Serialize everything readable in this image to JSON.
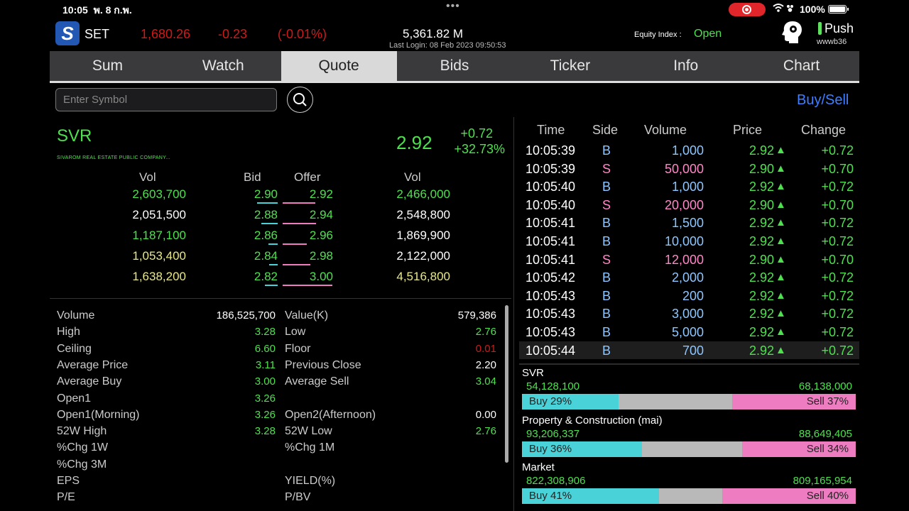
{
  "status_bar": {
    "time": "10:05",
    "date": "พ. 8 ก.พ.",
    "battery": "100%"
  },
  "header": {
    "market": "SET",
    "index": "1,680.26",
    "change": "-0.23",
    "change_pct": "(-0.01%)",
    "value": "5,361.82 M",
    "last_login": "Last Login: 08 Feb 2023 09:50:53",
    "equity_label": "Equity Index :",
    "equity_status": "Open",
    "push_label": "Push",
    "user": "wwwb36"
  },
  "tabs": [
    {
      "label": "Sum",
      "active": false
    },
    {
      "label": "Watch",
      "active": false
    },
    {
      "label": "Quote",
      "active": true
    },
    {
      "label": "Bids",
      "active": false
    },
    {
      "label": "Ticker",
      "active": false
    },
    {
      "label": "Info",
      "active": false
    },
    {
      "label": "Chart",
      "active": false
    }
  ],
  "search": {
    "placeholder": "Enter Symbol",
    "buysell_label": "Buy/Sell"
  },
  "quote": {
    "symbol": "SVR",
    "company": "SIVAROM REAL ESTATE PUBLIC COMPANY...",
    "last": "2.92",
    "change": "+0.72",
    "change_pct": "+32.73%"
  },
  "bidoffer": {
    "headers": {
      "bid_vol": "Vol",
      "bid": "Bid",
      "offer": "Offer",
      "offer_vol": "Vol"
    },
    "rows": [
      {
        "bid_vol": "2,603,700",
        "bid": "2.90",
        "offer": "2.92",
        "offer_vol": "2,466,000",
        "bid_share": 0.7,
        "offer_share": 0.65
      },
      {
        "bid_vol": "2,051,500",
        "bid": "2.88",
        "offer": "2.94",
        "offer_vol": "2,548,800",
        "bid_share": 0.55,
        "offer_share": 0.67
      },
      {
        "bid_vol": "1,187,100",
        "bid": "2.86",
        "offer": "2.96",
        "offer_vol": "1,869,900",
        "bid_share": 0.32,
        "offer_share": 0.49
      },
      {
        "bid_vol": "1,053,400",
        "bid": "2.84",
        "offer": "2.98",
        "offer_vol": "2,122,000",
        "bid_share": 0.28,
        "offer_share": 0.56
      },
      {
        "bid_vol": "1,638,200",
        "bid": "2.82",
        "offer": "3.00",
        "offer_vol": "4,516,800",
        "bid_share": 0.43,
        "offer_share": 1.0
      }
    ]
  },
  "stats": {
    "left": [
      {
        "label": "Volume",
        "value": "186,525,700",
        "color": "#ffffff"
      },
      {
        "label": "High",
        "value": "3.28",
        "color": "#4fe04f"
      },
      {
        "label": "Ceiling",
        "value": "6.60",
        "color": "#4fe04f"
      },
      {
        "label": "Average Price",
        "value": "3.11",
        "color": "#4fe04f"
      },
      {
        "label": "Average Buy",
        "value": "3.00",
        "color": "#4fe04f"
      },
      {
        "label": "Open1",
        "value": "3.26",
        "color": "#4fe04f"
      },
      {
        "label": "Open1(Morning)",
        "value": "3.26",
        "color": "#4fe04f"
      },
      {
        "label": "52W High",
        "value": "3.28",
        "color": "#4fe04f"
      },
      {
        "label": "%Chg 1W",
        "value": "",
        "color": "#ffffff"
      },
      {
        "label": "%Chg 3M",
        "value": "",
        "color": "#ffffff"
      },
      {
        "label": "EPS",
        "value": "",
        "color": "#ffffff"
      },
      {
        "label": "P/E",
        "value": "",
        "color": "#ffffff"
      }
    ],
    "right": [
      {
        "label": "Value(K)",
        "value": "579,386",
        "color": "#ffffff"
      },
      {
        "label": "Low",
        "value": "2.76",
        "color": "#4fe04f"
      },
      {
        "label": "Floor",
        "value": "0.01",
        "color": "#d01a1a"
      },
      {
        "label": "Previous Close",
        "value": "2.20",
        "color": "#ffffff"
      },
      {
        "label": "Average Sell",
        "value": "3.04",
        "color": "#4fe04f"
      },
      {
        "label": "",
        "value": "",
        "color": "#ffffff"
      },
      {
        "label": "Open2(Afternoon)",
        "value": "0.00",
        "color": "#ffffff"
      },
      {
        "label": "52W Low",
        "value": "2.76",
        "color": "#4fe04f"
      },
      {
        "label": "%Chg 1M",
        "value": "",
        "color": "#ffffff"
      },
      {
        "label": "",
        "value": "",
        "color": "#ffffff"
      },
      {
        "label": "YIELD(%)",
        "value": "",
        "color": "#ffffff"
      },
      {
        "label": "P/BV",
        "value": "",
        "color": "#ffffff"
      }
    ]
  },
  "ticker": {
    "headers": {
      "time": "Time",
      "side": "Side",
      "volume": "Volume",
      "price": "Price",
      "change": "Change"
    },
    "rows": [
      {
        "time": "10:05:39",
        "side": "B",
        "volume": "1,000",
        "price": "2.92",
        "change": "+0.72"
      },
      {
        "time": "10:05:39",
        "side": "S",
        "volume": "50,000",
        "price": "2.90",
        "change": "+0.70"
      },
      {
        "time": "10:05:40",
        "side": "B",
        "volume": "1,000",
        "price": "2.92",
        "change": "+0.72"
      },
      {
        "time": "10:05:40",
        "side": "S",
        "volume": "20,000",
        "price": "2.90",
        "change": "+0.70"
      },
      {
        "time": "10:05:41",
        "side": "B",
        "volume": "1,500",
        "price": "2.92",
        "change": "+0.72"
      },
      {
        "time": "10:05:41",
        "side": "B",
        "volume": "10,000",
        "price": "2.92",
        "change": "+0.72"
      },
      {
        "time": "10:05:41",
        "side": "S",
        "volume": "12,000",
        "price": "2.90",
        "change": "+0.70"
      },
      {
        "time": "10:05:42",
        "side": "B",
        "volume": "2,000",
        "price": "2.92",
        "change": "+0.72"
      },
      {
        "time": "10:05:43",
        "side": "B",
        "volume": "200",
        "price": "2.92",
        "change": "+0.72"
      },
      {
        "time": "10:05:43",
        "side": "B",
        "volume": "3,000",
        "price": "2.92",
        "change": "+0.72"
      },
      {
        "time": "10:05:43",
        "side": "B",
        "volume": "5,000",
        "price": "2.92",
        "change": "+0.72"
      },
      {
        "time": "10:05:44",
        "side": "B",
        "volume": "700",
        "price": "2.92",
        "change": "+0.72"
      }
    ]
  },
  "distribution": [
    {
      "title": "SVR",
      "buy_value": "54,128,100",
      "sell_value": "68,138,000",
      "buy_label": "Buy 29%",
      "sell_label": "Sell 37%",
      "buy_pct": 29,
      "sell_pct": 37
    },
    {
      "title": "Property & Construction (mai)",
      "buy_value": "93,206,337",
      "sell_value": "88,649,405",
      "buy_label": "Buy 36%",
      "sell_label": "Sell 34%",
      "buy_pct": 36,
      "sell_pct": 34
    },
    {
      "title": "Market",
      "buy_value": "822,308,906",
      "sell_value": "809,165,954",
      "buy_label": "Buy 41%",
      "sell_label": "Sell 40%",
      "buy_pct": 41,
      "sell_pct": 40
    }
  ],
  "colors": {
    "up": "#4fe04f",
    "down": "#d01a1a",
    "sell": "#ff86c8",
    "buy": "#8ec6ff",
    "buy_bar": "#49d3d8",
    "sell_bar": "#ee7cc1",
    "accent": "#3f7fff"
  }
}
